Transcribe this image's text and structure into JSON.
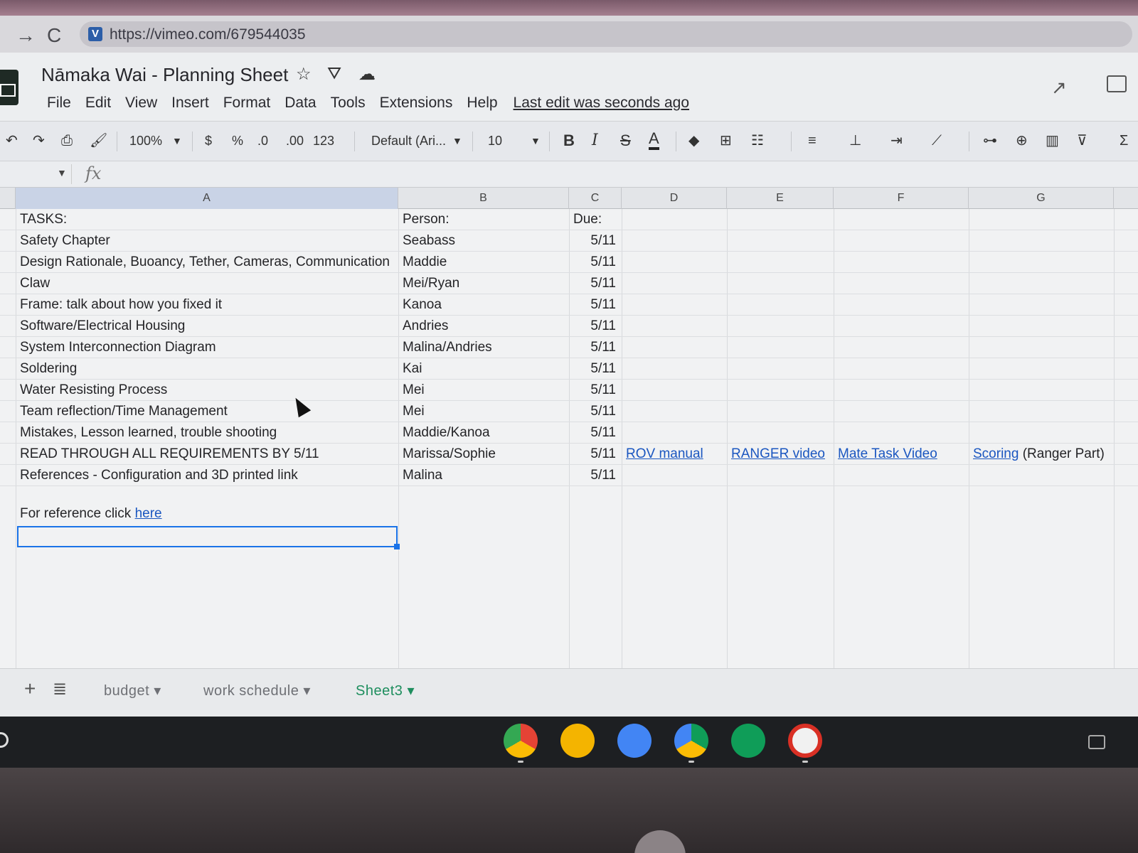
{
  "browser": {
    "url": "https://vimeo.com/679544035",
    "favicon_letter": "V",
    "back_glyph": "→",
    "reload_glyph": "C"
  },
  "doc": {
    "title": "Nāmaka Wai - Planning Sheet",
    "menu": [
      "File",
      "Edit",
      "View",
      "Insert",
      "Format",
      "Data",
      "Tools",
      "Extensions",
      "Help"
    ],
    "last_edit": "Last edit was seconds ago"
  },
  "toolbar": {
    "zoom": "100%",
    "currency": "$",
    "percent": "%",
    "dec_less": ".0",
    "dec_more": ".00",
    "number_format": "123",
    "font": "Default (Ari...",
    "font_size": "10",
    "bold": "B",
    "italic": "I",
    "strike": "S",
    "text_color": "A"
  },
  "formula": {
    "fx": "fx"
  },
  "grid": {
    "columns": [
      "A",
      "B",
      "C",
      "D",
      "E",
      "F",
      "G"
    ],
    "rows": [
      {
        "a": "TASKS:",
        "b": "Person:",
        "c": "Due:"
      },
      {
        "a": "Safety Chapter",
        "b": "Seabass",
        "c": "5/11"
      },
      {
        "a": "Design Rationale, Buoancy, Tether, Cameras, Communication",
        "b": "Maddie",
        "c": "5/11"
      },
      {
        "a": "Claw",
        "b": "Mei/Ryan",
        "c": "5/11"
      },
      {
        "a": "Frame: talk about how you fixed it",
        "b": "Kanoa",
        "c": "5/11"
      },
      {
        "a": "Software/Electrical Housing",
        "b": "Andries",
        "c": "5/11"
      },
      {
        "a": "System Interconnection Diagram",
        "b": "Malina/Andries",
        "c": "5/11"
      },
      {
        "a": "Soldering",
        "b": "Kai",
        "c": "5/11"
      },
      {
        "a": "Water Resisting Process",
        "b": "Mei",
        "c": "5/11"
      },
      {
        "a": "Team reflection/Time Management",
        "b": "Mei",
        "c": "5/11"
      },
      {
        "a": "Mistakes, Lesson learned, trouble shooting",
        "b": "Maddie/Kanoa",
        "c": "5/11"
      },
      {
        "a": "READ THROUGH ALL REQUIREMENTS BY 5/11",
        "b": "Marissa/Sophie",
        "c": "5/11",
        "d": "ROV manual",
        "e": "RANGER video",
        "f": "Mate Task Video",
        "g_link": "Scoring",
        "g_text": "(Ranger Part)"
      },
      {
        "a": "References - Configuration and 3D printed link",
        "b": "Malina",
        "c": "5/11"
      }
    ],
    "reference_text": "For reference click",
    "reference_link": "here"
  },
  "sheets": {
    "tabs": [
      "budget",
      "work schedule",
      "Sheet3"
    ],
    "active": "Sheet3"
  },
  "colors": {
    "link": "#1a56c0",
    "selection": "#1a73e8",
    "active_sheet": "#1e8e5e"
  }
}
